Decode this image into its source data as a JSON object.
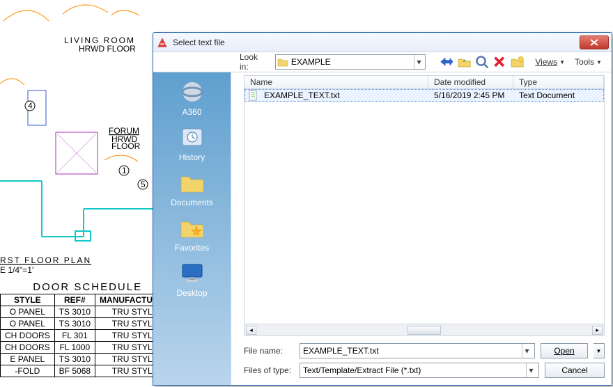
{
  "background": {
    "room1": "LIVING ROOM",
    "room1_sub": "HRWD FLOOR",
    "room2": "FORUM",
    "room2_sub": "HRWD\nFLOOR",
    "plan_title": "RST FLOOR PLAN",
    "plan_scale": "E 1/4\"=1'"
  },
  "schedule": {
    "title": "DOOR SCHEDULE",
    "headers": [
      "STYLE",
      "REF#",
      "MANUFACTURER"
    ],
    "rows": [
      [
        "O PANEL",
        "TS 3010",
        "TRU STYLE"
      ],
      [
        "O PANEL",
        "TS 3010",
        "TRU STYLE"
      ],
      [
        "CH DOORS",
        "FL 301",
        "TRU STYLE"
      ],
      [
        "CH DOORS",
        "FL 1000",
        "TRU STYLE"
      ],
      [
        "E PANEL",
        "TS 3010",
        "TRU STYLE"
      ],
      [
        "-FOLD",
        "BF 5068",
        "TRU STYLE"
      ]
    ]
  },
  "dialog": {
    "title": "Select text file",
    "close_aria": "Close",
    "lookin_label": "Look in:",
    "lookin_value": "EXAMPLE",
    "views": "Views",
    "tools": "Tools",
    "places": {
      "a360": "A360",
      "history": "History",
      "documents": "Documents",
      "favorites": "Favorites",
      "desktop": "Desktop"
    },
    "columns": {
      "name": "Name",
      "date": "Date modified",
      "type": "Type"
    },
    "file": {
      "name": "EXAMPLE_TEXT.txt",
      "date": "5/16/2019 2:45 PM",
      "type": "Text Document"
    },
    "filename_label": "File name:",
    "filename_value": "EXAMPLE_TEXT.txt",
    "filetype_label": "Files of type:",
    "filetype_value": "Text/Template/Extract File (*.txt)",
    "open": "Open",
    "cancel": "Cancel"
  },
  "icons": {
    "back": "back-arrow-icon",
    "up": "up-one-level-icon",
    "search": "search-icon",
    "delete": "delete-icon",
    "newfolder": "new-folder-icon"
  }
}
